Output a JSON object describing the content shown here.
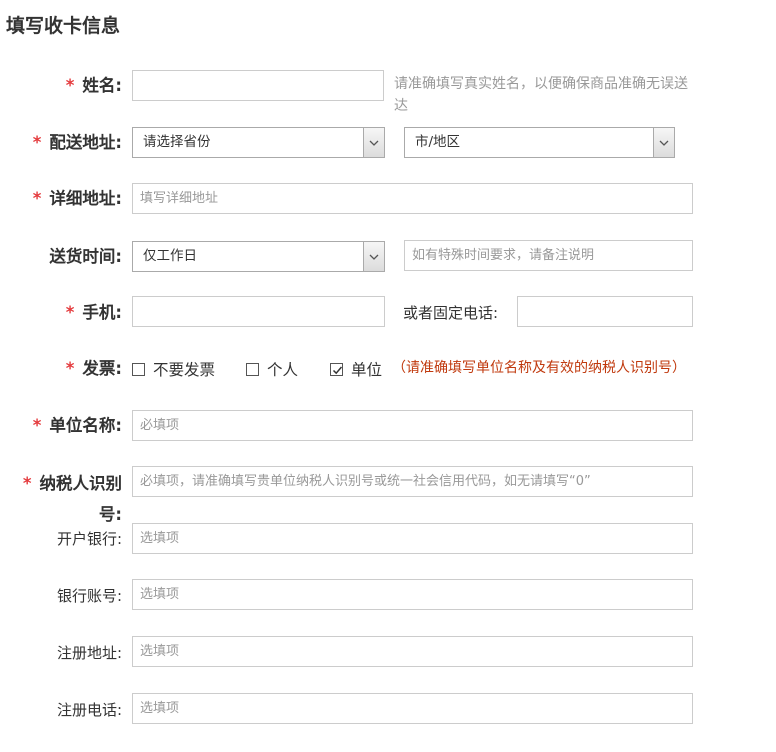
{
  "page_title": "填写收卡信息",
  "required_mark": "*",
  "colors": {
    "required": "#e4393c",
    "warning": "#c0390d",
    "border": "#cccccc",
    "placeholder": "#999999"
  },
  "name_field": {
    "label": "姓名:",
    "value": "",
    "hint": "请准确填写真实姓名，以便确保商品准确无误送达"
  },
  "address": {
    "label": "配送地址:",
    "province_selected": "请选择省份",
    "city_selected": "市/地区"
  },
  "detail_address": {
    "label": "详细地址:",
    "placeholder": "填写详细地址"
  },
  "delivery_time": {
    "label": "送货时间:",
    "selected": "仅工作日",
    "note_placeholder": "如有特殊时间要求，请备注说明"
  },
  "phone": {
    "label": "手机:",
    "value": "",
    "landline_label": "或者固定电话:",
    "landline_value": ""
  },
  "invoice": {
    "label": "发票:",
    "options": [
      {
        "label": "不要发票",
        "checked": false
      },
      {
        "label": "个人",
        "checked": false
      },
      {
        "label": "单位",
        "checked": true
      }
    ],
    "warning": "（请准确填写单位名称及有效的纳税人识别号）"
  },
  "company_name": {
    "label": "单位名称:",
    "placeholder": "必填项"
  },
  "taxpayer_id": {
    "label_line1": "纳税人识别",
    "label_line2": "号:",
    "placeholder": "必填项，请准确填写贵单位纳税人识别号或统一社会信用代码，如无请填写“0”"
  },
  "bank_name": {
    "label": "开户银行:",
    "placeholder": "选填项"
  },
  "bank_account": {
    "label": "银行账号:",
    "placeholder": "选填项"
  },
  "reg_address": {
    "label": "注册地址:",
    "placeholder": "选填项"
  },
  "reg_phone": {
    "label": "注册电话:",
    "placeholder": "选填项"
  }
}
